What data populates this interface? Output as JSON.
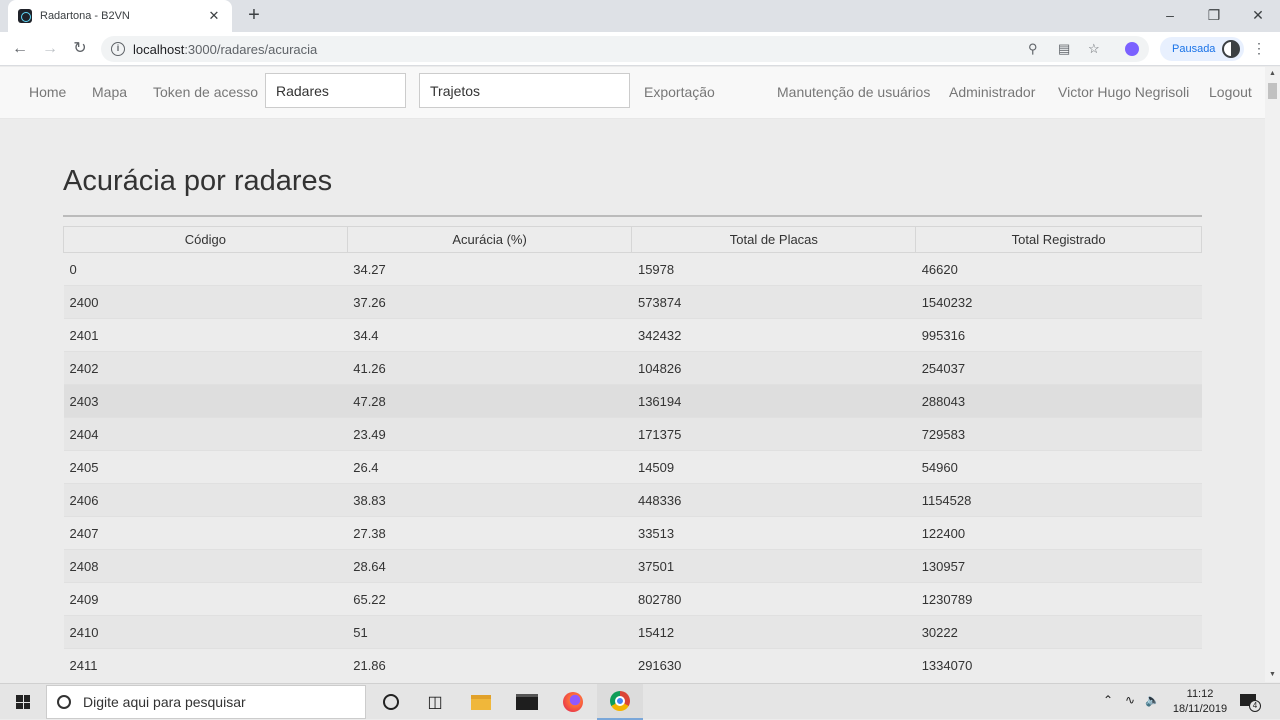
{
  "browser": {
    "tab_title": "Radartona - B2VN",
    "tab_close": "✕",
    "new_tab": "+",
    "url_host": "localhost",
    "url_path": ":3000/radares/acuracia",
    "profile_label": "Pausada"
  },
  "nav": {
    "home": "Home",
    "mapa": "Mapa",
    "token": "Token de acesso",
    "radares": "Radares",
    "trajetos": "Trajetos",
    "exportacao": "Exportação",
    "manutencao": "Manutenção de usuários",
    "administrador": "Administrador",
    "user": "Victor Hugo Negrisoli",
    "logout": "Logout"
  },
  "page": {
    "title": "Acurácia por radares"
  },
  "table": {
    "headers": [
      "Código",
      "Acurácia (%)",
      "Total de Placas",
      "Total Registrado"
    ],
    "rows": [
      [
        "0",
        "34.27",
        "15978",
        "46620"
      ],
      [
        "2400",
        "37.26",
        "573874",
        "1540232"
      ],
      [
        "2401",
        "34.4",
        "342432",
        "995316"
      ],
      [
        "2402",
        "41.26",
        "104826",
        "254037"
      ],
      [
        "2403",
        "47.28",
        "136194",
        "288043"
      ],
      [
        "2404",
        "23.49",
        "171375",
        "729583"
      ],
      [
        "2405",
        "26.4",
        "14509",
        "54960"
      ],
      [
        "2406",
        "38.83",
        "448336",
        "1154528"
      ],
      [
        "2407",
        "27.38",
        "33513",
        "122400"
      ],
      [
        "2408",
        "28.64",
        "37501",
        "130957"
      ],
      [
        "2409",
        "65.22",
        "802780",
        "1230789"
      ],
      [
        "2410",
        "51",
        "15412",
        "30222"
      ],
      [
        "2411",
        "21.86",
        "291630",
        "1334070"
      ]
    ]
  },
  "taskbar": {
    "search_placeholder": "Digite aqui para pesquisar",
    "time": "11:12",
    "date": "18/11/2019",
    "notifications": "4"
  }
}
